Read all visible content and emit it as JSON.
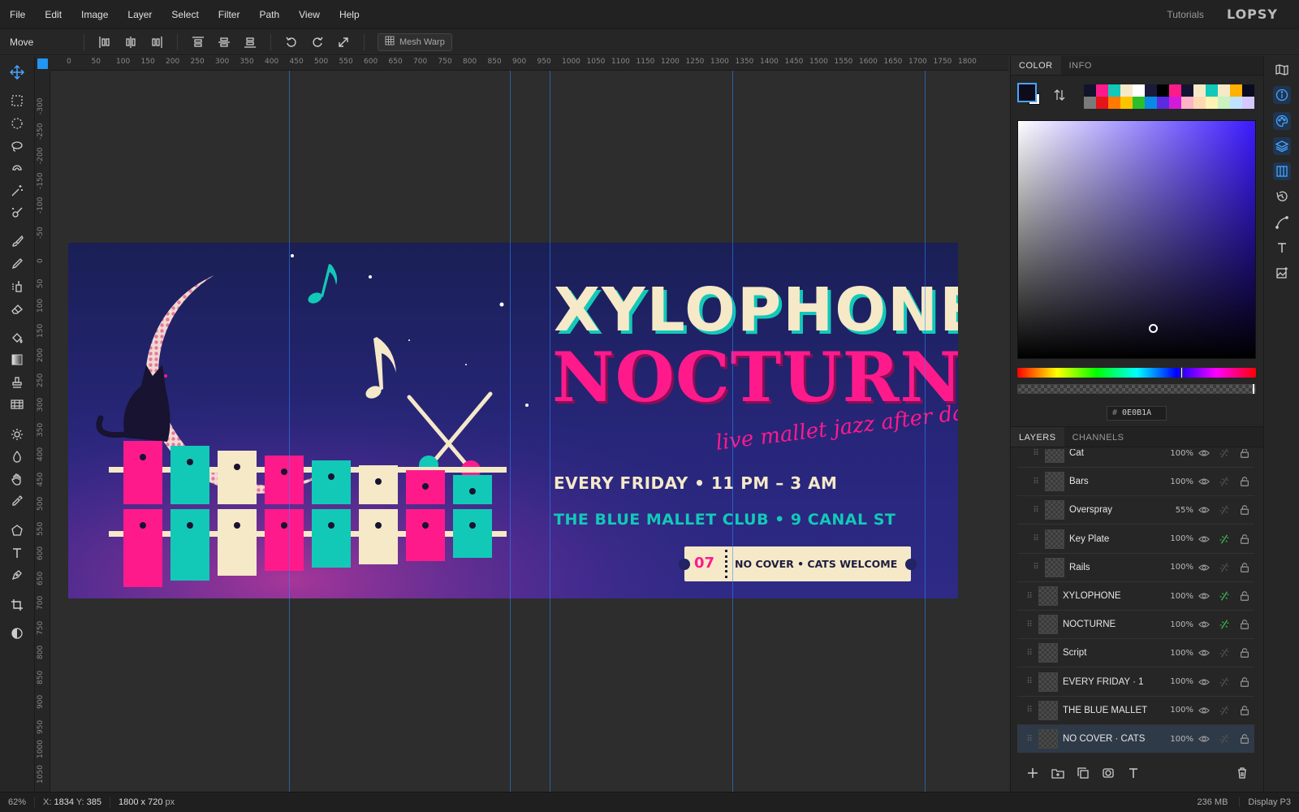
{
  "menu": {
    "items": [
      "File",
      "Edit",
      "Image",
      "Layer",
      "Select",
      "Filter",
      "Path",
      "View",
      "Help"
    ],
    "tutorials": "Tutorials",
    "logo": "LOPSY"
  },
  "toolbar": {
    "tool_name": "Move",
    "mesh_warp": "Mesh Warp"
  },
  "ruler": {
    "top": [
      "0",
      "50",
      "100",
      "150",
      "200",
      "250",
      "300",
      "350",
      "400",
      "450",
      "500",
      "550",
      "600",
      "650",
      "700",
      "750",
      "800",
      "850",
      "900",
      "950",
      "1000",
      "1050",
      "1100",
      "1150",
      "1200",
      "1250",
      "1300",
      "1350",
      "1400",
      "1450",
      "1500",
      "1550",
      "1600",
      "1650",
      "1700",
      "1750",
      "1800"
    ],
    "left": [
      "-300",
      "-250",
      "-200",
      "-150",
      "-100",
      "-50",
      "0",
      "50",
      "100",
      "150",
      "200",
      "250",
      "300",
      "350",
      "400",
      "450",
      "500",
      "550",
      "600",
      "650",
      "700",
      "750",
      "800",
      "850",
      "900",
      "950",
      "1000",
      "1050"
    ]
  },
  "artwork": {
    "title_top": "XYLOPHONE",
    "title_bottom": "NOCTURNE",
    "script": "live mallet jazz after dark",
    "when": "EVERY FRIDAY  •  11 PM – 3 AM",
    "where": "THE BLUE MALLET CLUB  •  9 CANAL ST",
    "ticket_num": "07",
    "ticket_text": "NO COVER  •  CATS WELCOME",
    "colors": {
      "bg": "#1e2060",
      "pink": "#ff1a8c",
      "teal": "#12c9b8",
      "cream": "#f5e9c8"
    }
  },
  "color_panel": {
    "tabs": [
      "COLOR",
      "INFO"
    ],
    "hex_prefix": "#",
    "hex": "0E0B1A",
    "fg_color": "#0e0b1a",
    "swatches": [
      "#12132b",
      "#ff1a8c",
      "#12c9b8",
      "#f5e9c8",
      "#ffffff",
      "#1a1a3a",
      "#000000",
      "#ff1a8c",
      "#141432",
      "#f5e9c8",
      "#12c9b8",
      "#f5e9c8",
      "#ffb000",
      "#0b0b20",
      "#7a7a7a",
      "#e5141b",
      "#ff7a00",
      "#ffc400",
      "#2bbf2b",
      "#0a8ae6",
      "#5b2be0",
      "#d21bd8",
      "#ffb3c7",
      "#ffd9b3",
      "#fff3b3",
      "#c9f2c0",
      "#bfe3ff",
      "#d6c8ff"
    ]
  },
  "layers_panel": {
    "tabs": [
      "LAYERS",
      "CHANNELS"
    ],
    "layers": [
      {
        "name": "Cat",
        "opacity": "100%",
        "fx": false,
        "indent": true
      },
      {
        "name": "Bars",
        "opacity": "100%",
        "fx": false,
        "indent": true
      },
      {
        "name": "Overspray",
        "opacity": "55%",
        "fx": false,
        "indent": true
      },
      {
        "name": "Key Plate",
        "opacity": "100%",
        "fx": true,
        "indent": true
      },
      {
        "name": "Rails",
        "opacity": "100%",
        "fx": false,
        "indent": true
      },
      {
        "name": "XYLOPHONE",
        "opacity": "100%",
        "fx": true,
        "indent": false
      },
      {
        "name": "NOCTURNE",
        "opacity": "100%",
        "fx": true,
        "indent": false
      },
      {
        "name": "Script",
        "opacity": "100%",
        "fx": false,
        "indent": false
      },
      {
        "name": "EVERY FRIDAY · 1",
        "opacity": "100%",
        "fx": false,
        "indent": false
      },
      {
        "name": "THE BLUE MALLET",
        "opacity": "100%",
        "fx": false,
        "indent": false
      },
      {
        "name": "NO COVER · CATS",
        "opacity": "100%",
        "fx": false,
        "indent": false,
        "selected": true
      }
    ]
  },
  "status": {
    "zoom": "62%",
    "x_label": "X:",
    "x": "1834",
    "y_label": "Y:",
    "y": "385",
    "dims": "1800 x 720",
    "dims_unit": "px",
    "memory": "236 MB",
    "display": "Display P3"
  }
}
